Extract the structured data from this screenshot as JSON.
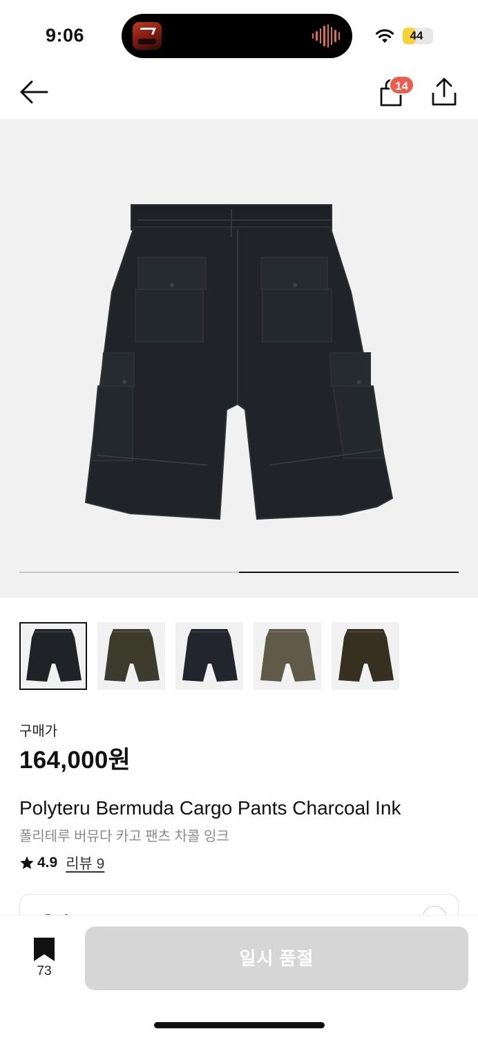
{
  "status_bar": {
    "time": "9:06",
    "battery_level": "44",
    "battery_fraction": 0.44,
    "accent": "#f7d233"
  },
  "nav": {
    "cart_badge": "14",
    "back_icon": "arrow-left-icon",
    "cart_icon": "shopping-bag-icon",
    "share_icon": "share-icon"
  },
  "gallery": {
    "slide_progress": "2/2",
    "thumbnails": [
      {
        "color": "#1f2226",
        "selected": true
      },
      {
        "color": "#3d3b2c",
        "selected": false
      },
      {
        "color": "#22252b",
        "selected": false
      },
      {
        "color": "#605a48",
        "selected": false
      },
      {
        "color": "#35301f",
        "selected": false
      }
    ]
  },
  "product": {
    "price_label": "구매가",
    "price": "164,000원",
    "name_en": "Polyteru Bermuda Cargo Pants Charcoal Ink",
    "name_ko": "폴리테루 버뮤다 카고 팬츠 차콜 잉크",
    "rating": "4.9",
    "review_label": "리뷰 9"
  },
  "option": {
    "label": "옵션"
  },
  "bottom": {
    "bookmark_count": "73",
    "soldout_label": "일시 품절",
    "button_color": "#d6d6d6"
  }
}
